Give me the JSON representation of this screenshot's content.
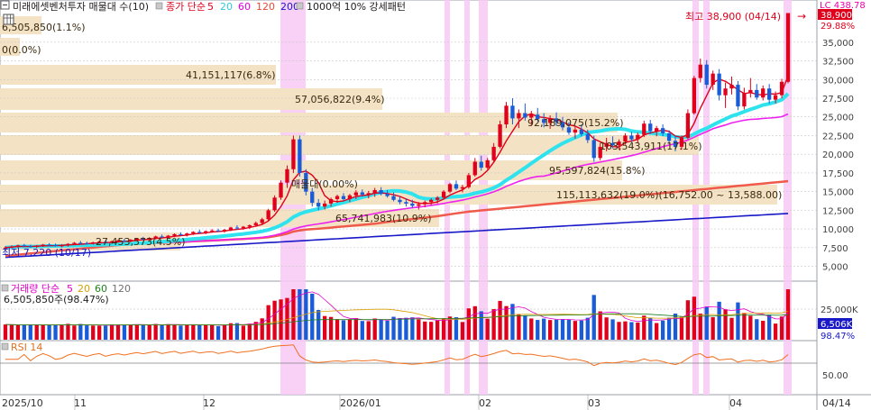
{
  "header": {
    "ticker_label": "미래에셋벤처투자 매물대 수(10)",
    "legend_prefix": "종가 단순",
    "ma_periods": [
      "5",
      "20",
      "60",
      "120",
      "200"
    ],
    "ma_colors": [
      "#e0001b",
      "#2ee3ee",
      "#ee22ee",
      "#ef5a4a",
      "#1818c8"
    ],
    "note": "1000억 10% 강세패턴"
  },
  "price_panel": {
    "yaxis_ticks": [
      "35,000",
      "32,500",
      "30,000",
      "27,500",
      "25,000",
      "22,500",
      "20,000",
      "17,500",
      "15,000",
      "12,500",
      "10,000",
      "7,500",
      "5,000"
    ],
    "yaxis_values": [
      35000,
      32500,
      30000,
      27500,
      25000,
      22500,
      20000,
      17500,
      15000,
      12500,
      10000,
      7500,
      5000
    ],
    "ylim": [
      3500,
      39200
    ],
    "current_price_tag": "38,900",
    "current_change_tag": "29.88%",
    "top_right_label": "LC 438.78",
    "high_marker": "최고 38,900 (04/14)",
    "low_marker": "최저 7,220 (10/17)",
    "annotations": [
      "6,505,850(1.1%)",
      "0(0.0%)",
      "41,151,117(6.8%)",
      "57,056,822(9.4%)",
      "92,189,075(15.2%)",
      "65,741,983(10.9%)",
      "27,453,573(4.5%)",
      "103,543,911(17.1%)",
      "95,597,824(15.8%)",
      "115,113,632(19.0%)(16,752.00 ~ 13,588.00)",
      "매물대(0.00%)"
    ]
  },
  "volume_panel": {
    "label": "거래량 단순",
    "ma_periods": [
      "5",
      "20",
      "60",
      "120"
    ],
    "ma_colors": [
      "#e000c8",
      "#d8a000",
      "#208020",
      "#707070"
    ],
    "info": "6,505,850주(98.47%)",
    "yaxis_ticks": [
      "25,000K"
    ],
    "current_tag": "6,506K",
    "current_pct_tag": "98.47%"
  },
  "rsi_panel": {
    "label": "RSI 14",
    "yaxis_ticks": [
      "50.00"
    ]
  },
  "xaxis": {
    "ticks": [
      "2025/10",
      "11",
      "12",
      "2026/01",
      "02",
      "03",
      "04",
      "04/14"
    ]
  },
  "chart_data": {
    "type": "candlestick",
    "title": "미래에셋벤처투자 매물대 수(10)",
    "x_range": [
      "2025/10",
      "04/14"
    ],
    "ylim": [
      3500,
      39200
    ],
    "candles_ohlc": [
      [
        7500,
        7700,
        7300,
        7500
      ],
      [
        7500,
        7800,
        7400,
        7650
      ],
      [
        7650,
        7900,
        7500,
        7800
      ],
      [
        7800,
        8000,
        7600,
        7700
      ],
      [
        7700,
        7900,
        7500,
        7600
      ],
      [
        7600,
        7850,
        7450,
        7750
      ],
      [
        7750,
        8000,
        7600,
        7900
      ],
      [
        7900,
        8100,
        7700,
        7850
      ],
      [
        7850,
        8050,
        7650,
        7750
      ],
      [
        7750,
        7950,
        7550,
        7800
      ],
      [
        7800,
        8100,
        7650,
        8000
      ],
      [
        8000,
        8250,
        7850,
        8150
      ],
      [
        8150,
        8400,
        7950,
        8100
      ],
      [
        8100,
        8300,
        7900,
        8050
      ],
      [
        8050,
        8300,
        7900,
        8200
      ],
      [
        8200,
        8450,
        8050,
        8300
      ],
      [
        8300,
        8500,
        8100,
        8200
      ],
      [
        8200,
        8450,
        8000,
        8350
      ],
      [
        8350,
        8600,
        8150,
        8450
      ],
      [
        8450,
        8700,
        8250,
        8400
      ],
      [
        8400,
        8650,
        8200,
        8550
      ],
      [
        8550,
        8800,
        8350,
        8700
      ],
      [
        8700,
        8950,
        8500,
        8650
      ],
      [
        8650,
        8900,
        8450,
        8800
      ],
      [
        8800,
        9100,
        8600,
        9000
      ],
      [
        9000,
        9250,
        8800,
        8900
      ],
      [
        8900,
        9200,
        8700,
        9100
      ],
      [
        9100,
        9400,
        8900,
        9300
      ],
      [
        9300,
        9550,
        9100,
        9200
      ],
      [
        9200,
        9500,
        9000,
        9400
      ],
      [
        9400,
        9700,
        9200,
        9600
      ],
      [
        9600,
        9900,
        9400,
        9500
      ],
      [
        9500,
        9800,
        9300,
        9700
      ],
      [
        9700,
        10000,
        9500,
        9800
      ],
      [
        9800,
        10050,
        9600,
        9700
      ],
      [
        9700,
        10000,
        9500,
        9900
      ],
      [
        9900,
        10300,
        9700,
        10200
      ],
      [
        10200,
        10500,
        9900,
        10100
      ],
      [
        10100,
        10400,
        9900,
        10300
      ],
      [
        10300,
        10600,
        10000,
        10500
      ],
      [
        10500,
        11000,
        10300,
        10800
      ],
      [
        10800,
        11500,
        10600,
        11300
      ],
      [
        11300,
        12700,
        11000,
        12500
      ],
      [
        12500,
        14500,
        12300,
        14200
      ],
      [
        14200,
        16500,
        13900,
        16200
      ],
      [
        16200,
        18500,
        15500,
        18000
      ],
      [
        18000,
        22500,
        17500,
        22000
      ],
      [
        22000,
        22500,
        17000,
        17500
      ],
      [
        17500,
        18000,
        14500,
        15000
      ],
      [
        15000,
        15500,
        13000,
        13500
      ],
      [
        13500,
        14000,
        12500,
        13000
      ],
      [
        13000,
        13800,
        12600,
        13400
      ],
      [
        13400,
        14200,
        13000,
        14000
      ],
      [
        14000,
        14600,
        13500,
        14400
      ],
      [
        14400,
        14800,
        13800,
        14000
      ],
      [
        14000,
        14700,
        13600,
        14500
      ],
      [
        14500,
        15200,
        14000,
        14900
      ],
      [
        14900,
        15300,
        14300,
        14600
      ],
      [
        14600,
        15100,
        14100,
        14800
      ],
      [
        14800,
        15500,
        14300,
        15200
      ],
      [
        15200,
        15600,
        14500,
        14700
      ],
      [
        14700,
        15200,
        14200,
        14400
      ],
      [
        14400,
        14900,
        13700,
        13900
      ],
      [
        13900,
        14400,
        13300,
        13600
      ],
      [
        13600,
        14100,
        13000,
        13400
      ],
      [
        13400,
        13900,
        12800,
        13100
      ],
      [
        13100,
        13600,
        12600,
        13300
      ],
      [
        13300,
        13800,
        12900,
        13600
      ],
      [
        13600,
        14100,
        13200,
        13900
      ],
      [
        13900,
        14400,
        13400,
        14200
      ],
      [
        14200,
        15200,
        14000,
        15000
      ],
      [
        15000,
        16200,
        14800,
        16000
      ],
      [
        16000,
        16500,
        15200,
        15400
      ],
      [
        15400,
        15900,
        14900,
        15600
      ],
      [
        15600,
        17500,
        15400,
        17200
      ],
      [
        17200,
        19500,
        17000,
        19000
      ],
      [
        19000,
        19800,
        17800,
        18200
      ],
      [
        18200,
        19500,
        18000,
        19200
      ],
      [
        19200,
        21500,
        19000,
        21000
      ],
      [
        21000,
        24500,
        20800,
        24000
      ],
      [
        24000,
        27000,
        23500,
        26500
      ],
      [
        26500,
        27500,
        24000,
        24800
      ],
      [
        24800,
        26000,
        23500,
        25500
      ],
      [
        25500,
        26800,
        24500,
        24900
      ],
      [
        24900,
        25800,
        23800,
        25300
      ],
      [
        25300,
        26200,
        24400,
        24700
      ],
      [
        24700,
        25500,
        23600,
        24200
      ],
      [
        24200,
        25200,
        23400,
        24800
      ],
      [
        24800,
        25600,
        23800,
        24300
      ],
      [
        24300,
        25000,
        23200,
        23600
      ],
      [
        23600,
        24300,
        22600,
        22900
      ],
      [
        22900,
        23700,
        22100,
        23300
      ],
      [
        23300,
        24000,
        22400,
        22700
      ],
      [
        22700,
        23300,
        21500,
        21900
      ],
      [
        21900,
        22500,
        19000,
        19500
      ],
      [
        19500,
        21500,
        19200,
        21000
      ],
      [
        21000,
        22200,
        20400,
        21500
      ],
      [
        21500,
        22400,
        20800,
        21200
      ],
      [
        21200,
        22000,
        20600,
        21700
      ],
      [
        21700,
        22800,
        21300,
        22500
      ],
      [
        22500,
        23000,
        21600,
        22000
      ],
      [
        22000,
        22900,
        21500,
        22600
      ],
      [
        22600,
        24500,
        22300,
        24100
      ],
      [
        24100,
        24600,
        22700,
        23100
      ],
      [
        23100,
        23800,
        22400,
        23500
      ],
      [
        23500,
        24000,
        22400,
        22800
      ],
      [
        22800,
        23200,
        21400,
        21800
      ],
      [
        21800,
        22500,
        20400,
        21000
      ],
      [
        21000,
        22500,
        20600,
        22200
      ],
      [
        22200,
        26000,
        22000,
        25500
      ],
      [
        25500,
        30500,
        25300,
        30200
      ],
      [
        30200,
        32800,
        29600,
        32000
      ],
      [
        32000,
        32600,
        28800,
        29300
      ],
      [
        29300,
        31200,
        28600,
        30800
      ],
      [
        30800,
        31400,
        27200,
        27900
      ],
      [
        27900,
        29600,
        26200,
        28800
      ],
      [
        28800,
        30400,
        28000,
        29300
      ],
      [
        29300,
        29800,
        25900,
        26400
      ],
      [
        26400,
        28900,
        26000,
        28200
      ],
      [
        28200,
        30200,
        27600,
        28600
      ],
      [
        28600,
        29400,
        27300,
        27600
      ],
      [
        27600,
        29200,
        27200,
        28800
      ],
      [
        28800,
        29400,
        26800,
        27300
      ],
      [
        27300,
        28400,
        26800,
        27900
      ],
      [
        27900,
        30100,
        27500,
        29700
      ],
      [
        29700,
        38900,
        29500,
        38900
      ]
    ],
    "highlight_bands": [
      "2025/12 mid",
      "2026/01 late",
      "2026/01 end",
      "2026/02 start",
      "2026/03 end",
      "2026/04 start",
      "04/14"
    ]
  }
}
